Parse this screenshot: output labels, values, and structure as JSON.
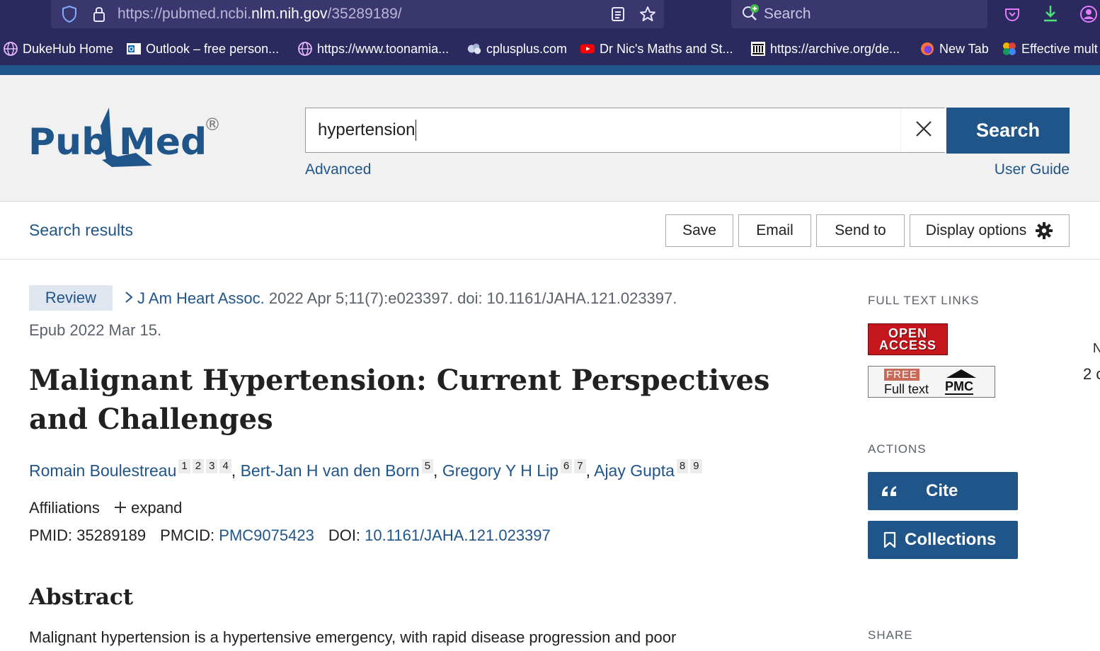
{
  "browser": {
    "url_prefix": "https://pubmed.ncbi.",
    "url_host": "nlm.nih.gov",
    "url_path": "/35289189/",
    "search_placeholder": "Search",
    "bookmarks": [
      {
        "label": "DukeHub Home"
      },
      {
        "label": "Outlook – free person..."
      },
      {
        "label": "https://www.toonamia..."
      },
      {
        "label": "cplusplus.com"
      },
      {
        "label": "Dr Nic's Maths and St..."
      },
      {
        "label": "https://archive.org/de..."
      },
      {
        "label": "New Tab"
      },
      {
        "label": "Effective mult"
      }
    ]
  },
  "header": {
    "logo_text_pub": "Pub",
    "logo_text_med": "Med",
    "logo_mark": "®",
    "search_value": "hypertension",
    "search_button": "Search",
    "advanced_link": "Advanced",
    "user_guide_link": "User Guide"
  },
  "toolbar": {
    "search_results": "Search results",
    "save": "Save",
    "email": "Email",
    "send_to": "Send to",
    "display_options": "Display options"
  },
  "article": {
    "badge": "Review",
    "journal": "J Am Heart Assoc.",
    "citation_rest": " 2022 Apr 5;11(7):e023397. doi: 10.1161/JAHA.121.023397.",
    "epub": "Epub 2022 Mar 15.",
    "title": "Malignant Hypertension: Current Perspectives and Challenges",
    "authors": [
      {
        "name": "Romain Boulestreau",
        "affs": [
          "1",
          "2",
          "3",
          "4"
        ]
      },
      {
        "name": "Bert-Jan H van den Born",
        "affs": [
          "5"
        ]
      },
      {
        "name": "Gregory Y H Lip",
        "affs": [
          "6",
          "7"
        ]
      },
      {
        "name": "Ajay Gupta",
        "affs": [
          "8",
          "9"
        ]
      }
    ],
    "affiliations_label": "Affiliations",
    "expand_label": "expand",
    "pmid_label": "PMID:",
    "pmid": "35289189",
    "pmcid_label": "PMCID:",
    "pmcid": "PMC9075423",
    "doi_label": "DOI:",
    "doi": "10.1161/JAHA.121.023397",
    "abstract_heading": "Abstract",
    "abstract_text": "Malignant hypertension is a hypertensive emergency, with rapid disease progression and poor"
  },
  "sidebar": {
    "full_text_links": "FULL TEXT LINKS",
    "open_access_line1": "OPEN",
    "open_access_line2": "ACCESS",
    "pmc_free": "FREE",
    "pmc_fulltext": "Full text",
    "pmc_label": "PMC",
    "actions": "ACTIONS",
    "cite": "Cite",
    "collections": "Collections",
    "share": "SHARE"
  },
  "edge": {
    "line1": "N",
    "line2": "2 c"
  },
  "colors": {
    "brand_blue": "#20558a",
    "chrome_bg": "#2b2a5e",
    "open_access_red": "#c4161c"
  }
}
